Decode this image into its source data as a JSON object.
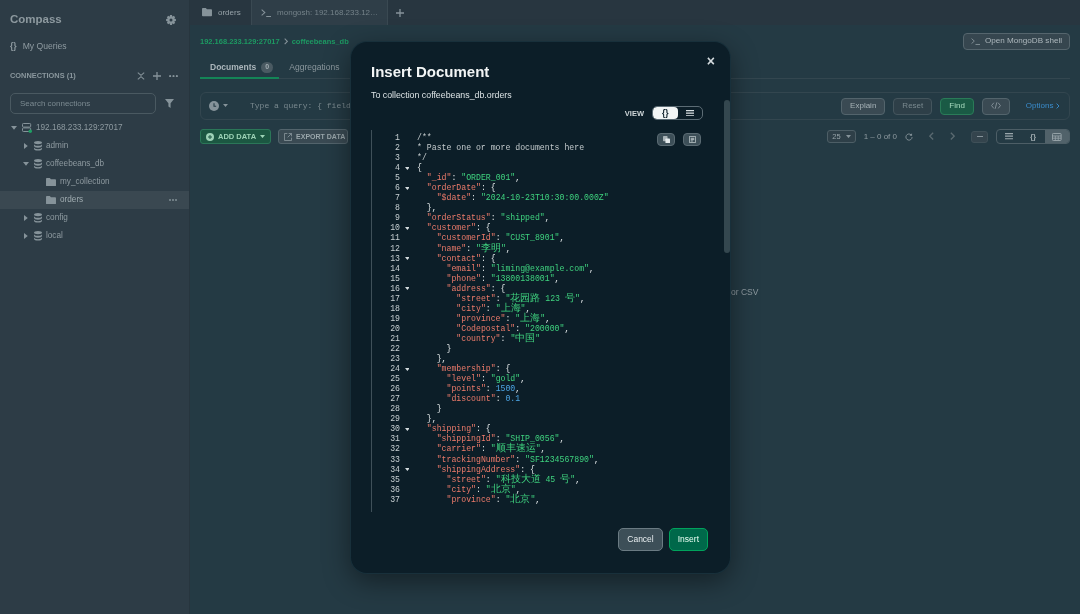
{
  "sidebar": {
    "title": "Compass",
    "my_queries": {
      "icon": "{}",
      "label": "My Queries"
    },
    "connections_heading": "CONNECTIONS (1)",
    "search": {
      "placeholder": "Search connections"
    },
    "tree": [
      {
        "label": "192.168.233.129:27017",
        "kind": "connection",
        "expanded": true,
        "selected": false,
        "children": [
          {
            "label": "admin",
            "kind": "database",
            "expanded": false,
            "selected": false
          },
          {
            "label": "coffeebeans_db",
            "kind": "database",
            "expanded": true,
            "selected": false,
            "children": [
              {
                "label": "my_collection",
                "kind": "collection",
                "selected": false
              },
              {
                "label": "orders",
                "kind": "collection",
                "selected": true
              }
            ]
          },
          {
            "label": "config",
            "kind": "database",
            "expanded": false,
            "selected": false
          },
          {
            "label": "local",
            "kind": "database",
            "expanded": false,
            "selected": false
          }
        ]
      }
    ]
  },
  "workspace_tabs": [
    {
      "label": "orders",
      "kind": "collection",
      "selected": true
    },
    {
      "label": "mongosh: 192.168.233.12…",
      "kind": "shell",
      "selected": false
    }
  ],
  "breadcrumb": [
    "192.168.233.129:27017",
    "coffeebeans_db"
  ],
  "shell_button": "Open MongoDB shell",
  "collection_tabs": [
    {
      "label": "Documents",
      "count": "0",
      "selected": true
    },
    {
      "label": "Aggregations",
      "selected": false
    }
  ],
  "query_bar": {
    "placeholder": "Type a query: { field",
    "buttons": [
      {
        "label": "Explain",
        "kind": "secondary",
        "disabled": false
      },
      {
        "label": "Reset",
        "kind": "secondary",
        "disabled": true
      },
      {
        "label": "Find",
        "kind": "primary",
        "disabled": false
      }
    ],
    "options_link": "Options"
  },
  "toolbar": {
    "add_data": "ADD DATA",
    "export_data": "EXPORT DATA",
    "page_size": "25",
    "range": "1 – 0 of 0",
    "view_options": [
      {
        "kind": "list",
        "selected": false
      },
      {
        "kind": "json",
        "label": "{}",
        "selected": false
      },
      {
        "kind": "table",
        "selected": true
      }
    ]
  },
  "empty_state": "or CSV",
  "modal": {
    "title": "Insert Document",
    "subtitle": "To collection coffeebeans_db.orders",
    "close": "×",
    "view_label": "VIEW",
    "view_options": [
      {
        "kind": "json",
        "label": "{}",
        "selected": true
      },
      {
        "kind": "list",
        "selected": false
      }
    ],
    "lines": [
      {
        "number": "1",
        "tokens": [
          {
            "kind": "comment",
            "text": "/**"
          }
        ]
      },
      {
        "number": "2",
        "tokens": [
          {
            "kind": "comment",
            "text": "* Paste one or more documents here"
          }
        ]
      },
      {
        "number": "3",
        "tokens": [
          {
            "kind": "comment",
            "text": "*/"
          }
        ]
      },
      {
        "number": "4",
        "expanded": true,
        "tokens": [
          {
            "kind": "punct",
            "text": "{"
          }
        ]
      },
      {
        "number": "5",
        "tokens": [
          {
            "kind": "key",
            "text": "  \"_id\""
          },
          {
            "kind": "punct",
            "text": ": "
          },
          {
            "kind": "string",
            "text": "\"ORDER_001\""
          },
          {
            "kind": "punct",
            "text": ","
          }
        ]
      },
      {
        "number": "6",
        "expanded": true,
        "tokens": [
          {
            "kind": "key",
            "text": "  \"orderDate\""
          },
          {
            "kind": "punct",
            "text": ": {"
          }
        ]
      },
      {
        "number": "7",
        "tokens": [
          {
            "kind": "key",
            "text": "    \"$date\""
          },
          {
            "kind": "punct",
            "text": ": "
          },
          {
            "kind": "string",
            "text": "\"2024-10-23T10:30:00.000Z\""
          }
        ]
      },
      {
        "number": "8",
        "tokens": [
          {
            "kind": "punct",
            "text": "  },"
          }
        ]
      },
      {
        "number": "9",
        "tokens": [
          {
            "kind": "key",
            "text": "  \"orderStatus\""
          },
          {
            "kind": "punct",
            "text": ": "
          },
          {
            "kind": "string",
            "text": "\"shipped\""
          },
          {
            "kind": "punct",
            "text": ","
          }
        ]
      },
      {
        "number": "10",
        "expanded": true,
        "tokens": [
          {
            "kind": "key",
            "text": "  \"customer\""
          },
          {
            "kind": "punct",
            "text": ": {"
          }
        ]
      },
      {
        "number": "11",
        "tokens": [
          {
            "kind": "key",
            "text": "    \"customerId\""
          },
          {
            "kind": "punct",
            "text": ": "
          },
          {
            "kind": "string",
            "text": "\"CUST_8901\""
          },
          {
            "kind": "punct",
            "text": ","
          }
        ]
      },
      {
        "number": "12",
        "tokens": [
          {
            "kind": "key",
            "text": "    \"name\""
          },
          {
            "kind": "punct",
            "text": ": "
          },
          {
            "kind": "string",
            "text": "\"李明\""
          },
          {
            "kind": "punct",
            "text": ","
          }
        ]
      },
      {
        "number": "13",
        "expanded": true,
        "tokens": [
          {
            "kind": "key",
            "text": "    \"contact\""
          },
          {
            "kind": "punct",
            "text": ": {"
          }
        ]
      },
      {
        "number": "14",
        "tokens": [
          {
            "kind": "key",
            "text": "      \"email\""
          },
          {
            "kind": "punct",
            "text": ": "
          },
          {
            "kind": "string",
            "text": "\"liming@example.com\""
          },
          {
            "kind": "punct",
            "text": ","
          }
        ]
      },
      {
        "number": "15",
        "tokens": [
          {
            "kind": "key",
            "text": "      \"phone\""
          },
          {
            "kind": "punct",
            "text": ": "
          },
          {
            "kind": "string",
            "text": "\"13800138001\""
          },
          {
            "kind": "punct",
            "text": ","
          }
        ]
      },
      {
        "number": "16",
        "expanded": true,
        "tokens": [
          {
            "kind": "key",
            "text": "      \"address\""
          },
          {
            "kind": "punct",
            "text": ": {"
          }
        ]
      },
      {
        "number": "17",
        "tokens": [
          {
            "kind": "key",
            "text": "        \"street\""
          },
          {
            "kind": "punct",
            "text": ": "
          },
          {
            "kind": "string",
            "text": "\"花园路 123 号\""
          },
          {
            "kind": "punct",
            "text": ","
          }
        ]
      },
      {
        "number": "18",
        "tokens": [
          {
            "kind": "key",
            "text": "        \"city\""
          },
          {
            "kind": "punct",
            "text": ": "
          },
          {
            "kind": "string",
            "text": "\"上海\""
          },
          {
            "kind": "punct",
            "text": ","
          }
        ]
      },
      {
        "number": "19",
        "tokens": [
          {
            "kind": "key",
            "text": "        \"province\""
          },
          {
            "kind": "punct",
            "text": ": "
          },
          {
            "kind": "string",
            "text": "\"上海\""
          },
          {
            "kind": "punct",
            "text": ","
          }
        ]
      },
      {
        "number": "20",
        "tokens": [
          {
            "kind": "key",
            "text": "        \"Codepostal\""
          },
          {
            "kind": "punct",
            "text": ": "
          },
          {
            "kind": "string",
            "text": "\"200000\""
          },
          {
            "kind": "punct",
            "text": ","
          }
        ]
      },
      {
        "number": "21",
        "tokens": [
          {
            "kind": "key",
            "text": "        \"country\""
          },
          {
            "kind": "punct",
            "text": ": "
          },
          {
            "kind": "string",
            "text": "\"中国\""
          }
        ]
      },
      {
        "number": "22",
        "tokens": [
          {
            "kind": "punct",
            "text": "      }"
          }
        ]
      },
      {
        "number": "23",
        "tokens": [
          {
            "kind": "punct",
            "text": "    },"
          }
        ]
      },
      {
        "number": "24",
        "expanded": true,
        "tokens": [
          {
            "kind": "key",
            "text": "    \"membership\""
          },
          {
            "kind": "punct",
            "text": ": {"
          }
        ]
      },
      {
        "number": "25",
        "tokens": [
          {
            "kind": "key",
            "text": "      \"level\""
          },
          {
            "kind": "punct",
            "text": ": "
          },
          {
            "kind": "string",
            "text": "\"gold\""
          },
          {
            "kind": "punct",
            "text": ","
          }
        ]
      },
      {
        "number": "26",
        "tokens": [
          {
            "kind": "key",
            "text": "      \"points\""
          },
          {
            "kind": "punct",
            "text": ": "
          },
          {
            "kind": "number",
            "text": "1500"
          },
          {
            "kind": "punct",
            "text": ","
          }
        ]
      },
      {
        "number": "27",
        "tokens": [
          {
            "kind": "key",
            "text": "      \"discount\""
          },
          {
            "kind": "punct",
            "text": ": "
          },
          {
            "kind": "number",
            "text": "0.1"
          }
        ]
      },
      {
        "number": "28",
        "tokens": [
          {
            "kind": "punct",
            "text": "    }"
          }
        ]
      },
      {
        "number": "29",
        "tokens": [
          {
            "kind": "punct",
            "text": "  },"
          }
        ]
      },
      {
        "number": "30",
        "expanded": true,
        "tokens": [
          {
            "kind": "key",
            "text": "  \"shipping\""
          },
          {
            "kind": "punct",
            "text": ": {"
          }
        ]
      },
      {
        "number": "31",
        "tokens": [
          {
            "kind": "key",
            "text": "    \"shippingId\""
          },
          {
            "kind": "punct",
            "text": ": "
          },
          {
            "kind": "string",
            "text": "\"SHIP_0056\""
          },
          {
            "kind": "punct",
            "text": ","
          }
        ]
      },
      {
        "number": "32",
        "tokens": [
          {
            "kind": "key",
            "text": "    \"carrier\""
          },
          {
            "kind": "punct",
            "text": ": "
          },
          {
            "kind": "string",
            "text": "\"顺丰速运\""
          },
          {
            "kind": "punct",
            "text": ","
          }
        ]
      },
      {
        "number": "33",
        "tokens": [
          {
            "kind": "key",
            "text": "    \"trackingNumber\""
          },
          {
            "kind": "punct",
            "text": ": "
          },
          {
            "kind": "string",
            "text": "\"SF1234567890\""
          },
          {
            "kind": "punct",
            "text": ","
          }
        ]
      },
      {
        "number": "34",
        "expanded": true,
        "tokens": [
          {
            "kind": "key",
            "text": "    \"shippingAddress\""
          },
          {
            "kind": "punct",
            "text": ": {"
          }
        ]
      },
      {
        "number": "35",
        "tokens": [
          {
            "kind": "key",
            "text": "      \"street\""
          },
          {
            "kind": "punct",
            "text": ": "
          },
          {
            "kind": "string",
            "text": "\"科技大道 45 号\""
          },
          {
            "kind": "punct",
            "text": ","
          }
        ]
      },
      {
        "number": "36",
        "tokens": [
          {
            "kind": "key",
            "text": "      \"city\""
          },
          {
            "kind": "punct",
            "text": ": "
          },
          {
            "kind": "string",
            "text": "\"北京\""
          },
          {
            "kind": "punct",
            "text": ","
          }
        ]
      },
      {
        "number": "37",
        "tokens": [
          {
            "kind": "key",
            "text": "      \"province\""
          },
          {
            "kind": "punct",
            "text": ": "
          },
          {
            "kind": "string",
            "text": "\"北京\""
          },
          {
            "kind": "punct",
            "text": ","
          }
        ]
      }
    ],
    "buttons": [
      {
        "label": "Cancel",
        "kind": "secondary"
      },
      {
        "label": "Insert",
        "kind": "primary"
      }
    ]
  }
}
